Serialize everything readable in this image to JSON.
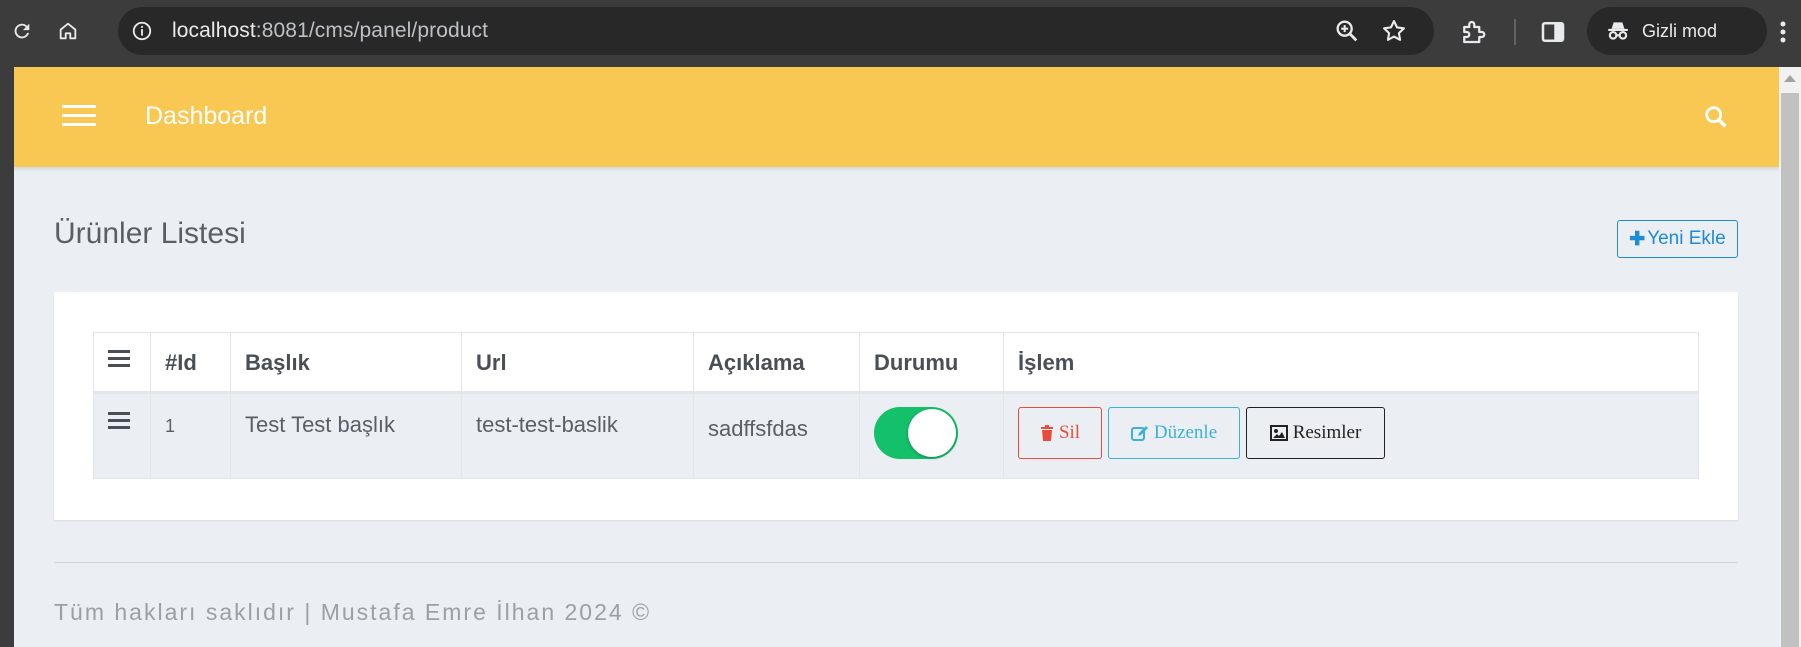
{
  "browser": {
    "url_host": "localhost",
    "url_rest": ":8081/cms/panel/product",
    "incognito_label": "Gizli mod"
  },
  "app": {
    "brand": "Dashboard"
  },
  "page": {
    "title": "Ürünler Listesi",
    "add_button": "Yeni Ekle"
  },
  "table": {
    "headers": [
      "#Id",
      "Başlık",
      "Url",
      "Açıklama",
      "Durumu",
      "İşlem"
    ],
    "rows": [
      {
        "id": "1",
        "title": "Test Test başlık",
        "url": "test-test-baslik",
        "description": "sadffsfdas",
        "status_on": true,
        "actions": {
          "delete": "Sil",
          "edit": "Düzenle",
          "images": "Resimler"
        }
      }
    ]
  },
  "footer": {
    "text": "Tüm hakları saklıdır | Mustafa Emre İlhan 2024 ©"
  },
  "colors": {
    "topbar": "#f8c853",
    "primary": "#1f8bd6",
    "toggle_on": "#14c06a",
    "danger": "#e74c3c",
    "info": "#39b3d7"
  },
  "icons": [
    "reload-icon",
    "home-icon",
    "site-info-icon",
    "zoom-icon",
    "bookmark-star-icon",
    "extensions-icon",
    "side-panel-icon",
    "incognito-icon",
    "menu-kebab-icon",
    "hamburger-menu-icon",
    "search-icon",
    "drag-handle-icon",
    "trash-icon",
    "edit-icon",
    "image-icon",
    "plus-icon"
  ]
}
